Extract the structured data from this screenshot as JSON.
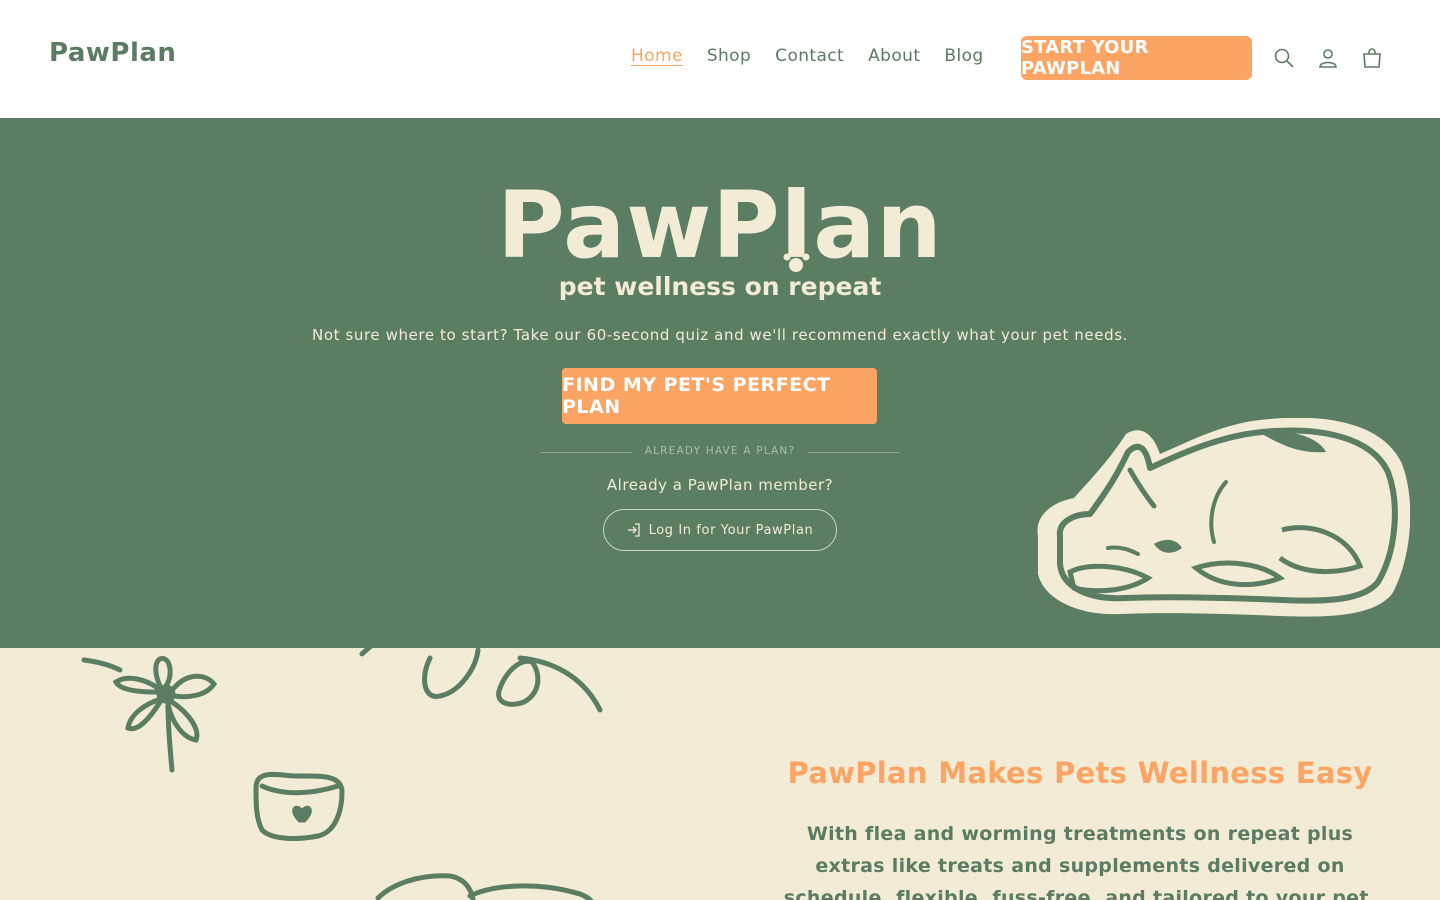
{
  "header": {
    "logo": "PawPlan",
    "nav": [
      "Home",
      "Shop",
      "Contact",
      "About",
      "Blog"
    ],
    "active_nav": "Home",
    "cta": "START YOUR PAWPLAN",
    "icons": [
      "search-icon",
      "account-icon",
      "cart-icon"
    ]
  },
  "hero": {
    "logo": "PawPlan",
    "tagline": "pet wellness on repeat",
    "subtitle": "Not sure where to start? Take our 60-second quiz and we'll recommend exactly what your pet needs.",
    "cta": "FIND MY PET'S PERFECT PLAN",
    "divider_text": "ALREADY HAVE A PLAN?",
    "member_text": "Already a PawPlan member?",
    "login_label": "Log In for Your PawPlan"
  },
  "section": {
    "title": "PawPlan Makes Pets Wellness Easy",
    "body": "With flea and worming treatments on repeat plus extras like treats and supplements delivered on schedule, flexible, fuss-free, and tailored to your pet."
  },
  "colors": {
    "green": "#5b7d62",
    "cream": "#f2ebd6",
    "orange": "#fba463"
  }
}
